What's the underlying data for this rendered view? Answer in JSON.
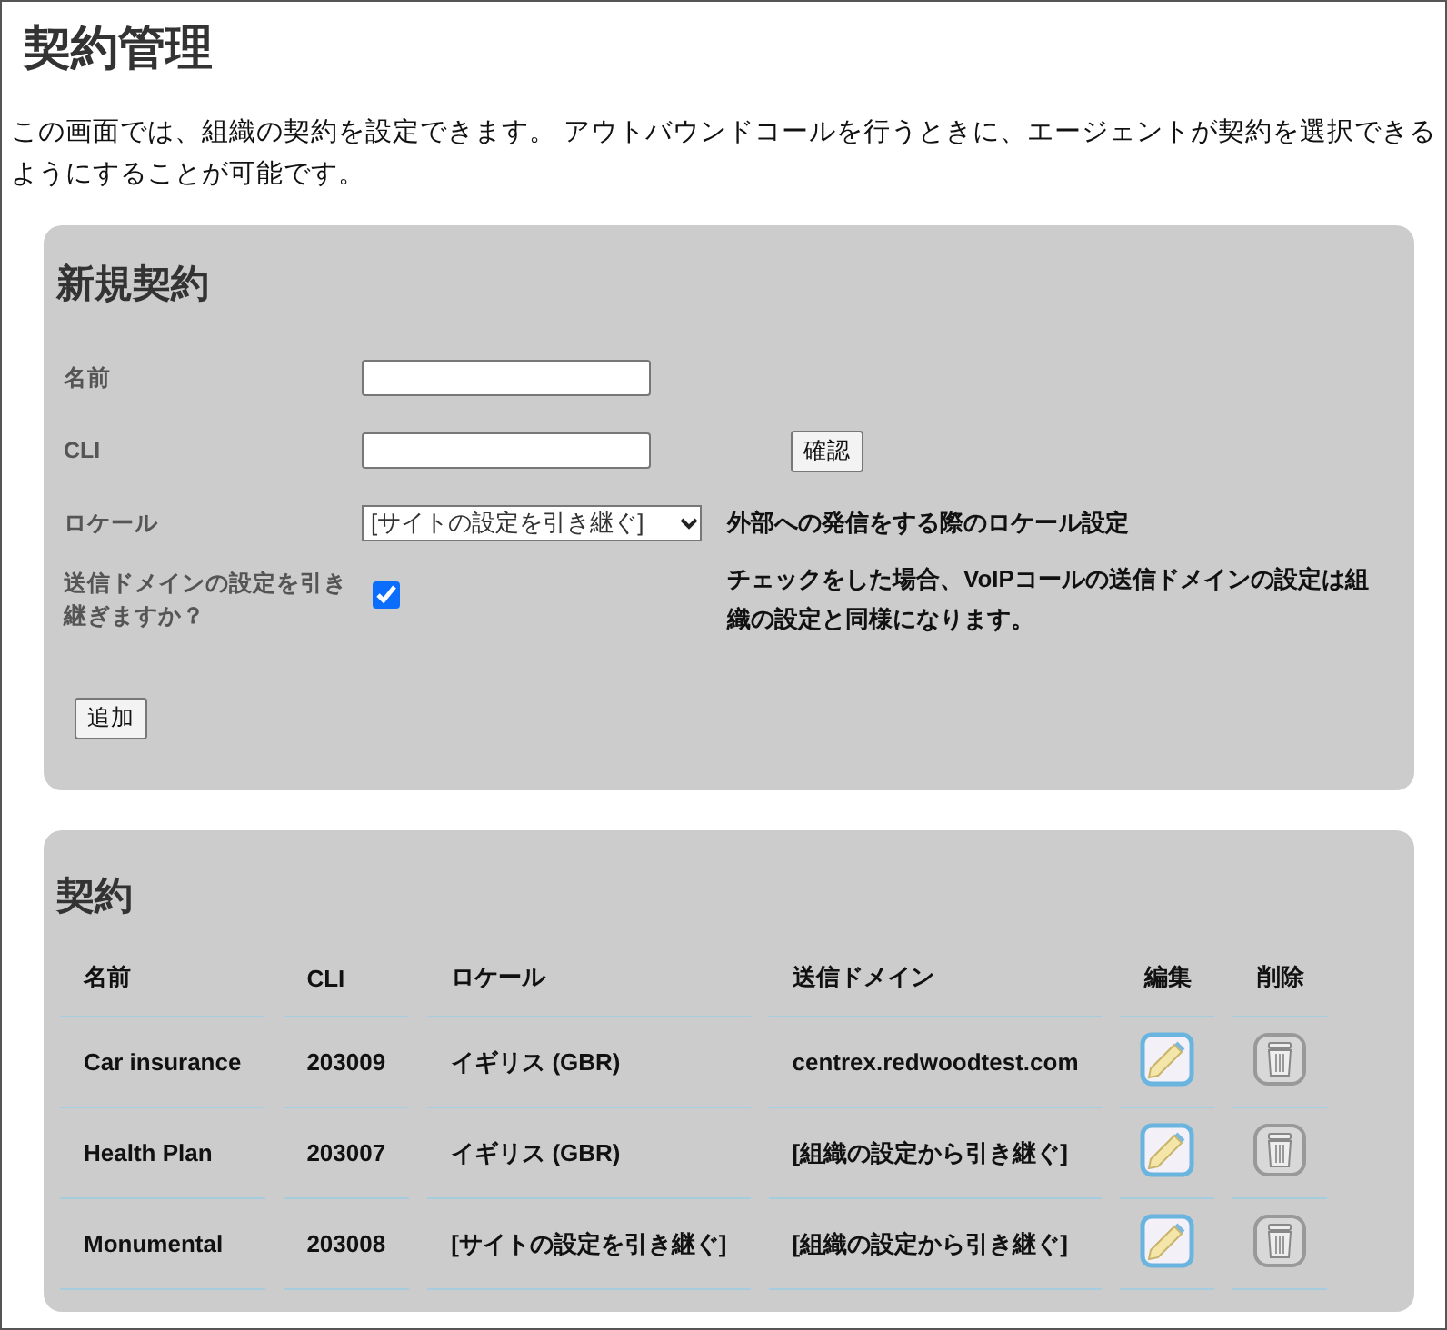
{
  "page": {
    "title": "契約管理",
    "description": "この画面では、組織の契約を設定できます。 アウトバウンドコールを行うときに、エージェントが契約を選択できるようにすることが可能です。"
  },
  "new_contract": {
    "title": "新規契約",
    "fields": [
      {
        "kind": "text",
        "label": "名前"
      },
      {
        "kind": "text",
        "label": "CLI",
        "button": "確認"
      },
      {
        "kind": "select",
        "label": "ロケール",
        "value": "[サイトの設定を引き継ぐ]",
        "hint": "外部への発信をする際のロケール設定"
      },
      {
        "kind": "checkbox",
        "label": "送信ドメインの設定を引き継ぎますか？",
        "checked": true,
        "hint": "チェックをした場合、VoIPコールの送信ドメインの設定は組織の設定と同様になります。"
      }
    ],
    "submit": "追加"
  },
  "contracts": {
    "title": "契約",
    "columns": [
      "名前",
      "CLI",
      "ロケール",
      "送信ドメイン",
      "編集",
      "削除"
    ],
    "rows": [
      {
        "name": "Car insurance",
        "cli": "203009",
        "locale": "イギリス (GBR)",
        "domain": "centrex.redwoodtest.com"
      },
      {
        "name": "Health Plan",
        "cli": "203007",
        "locale": "イギリス (GBR)",
        "domain": "[組織の設定から引き継ぐ]"
      },
      {
        "name": "Monumental",
        "cli": "203008",
        "locale": "[サイトの設定を引き継ぐ]",
        "domain": "[組織の設定から引き継ぐ]"
      }
    ]
  }
}
